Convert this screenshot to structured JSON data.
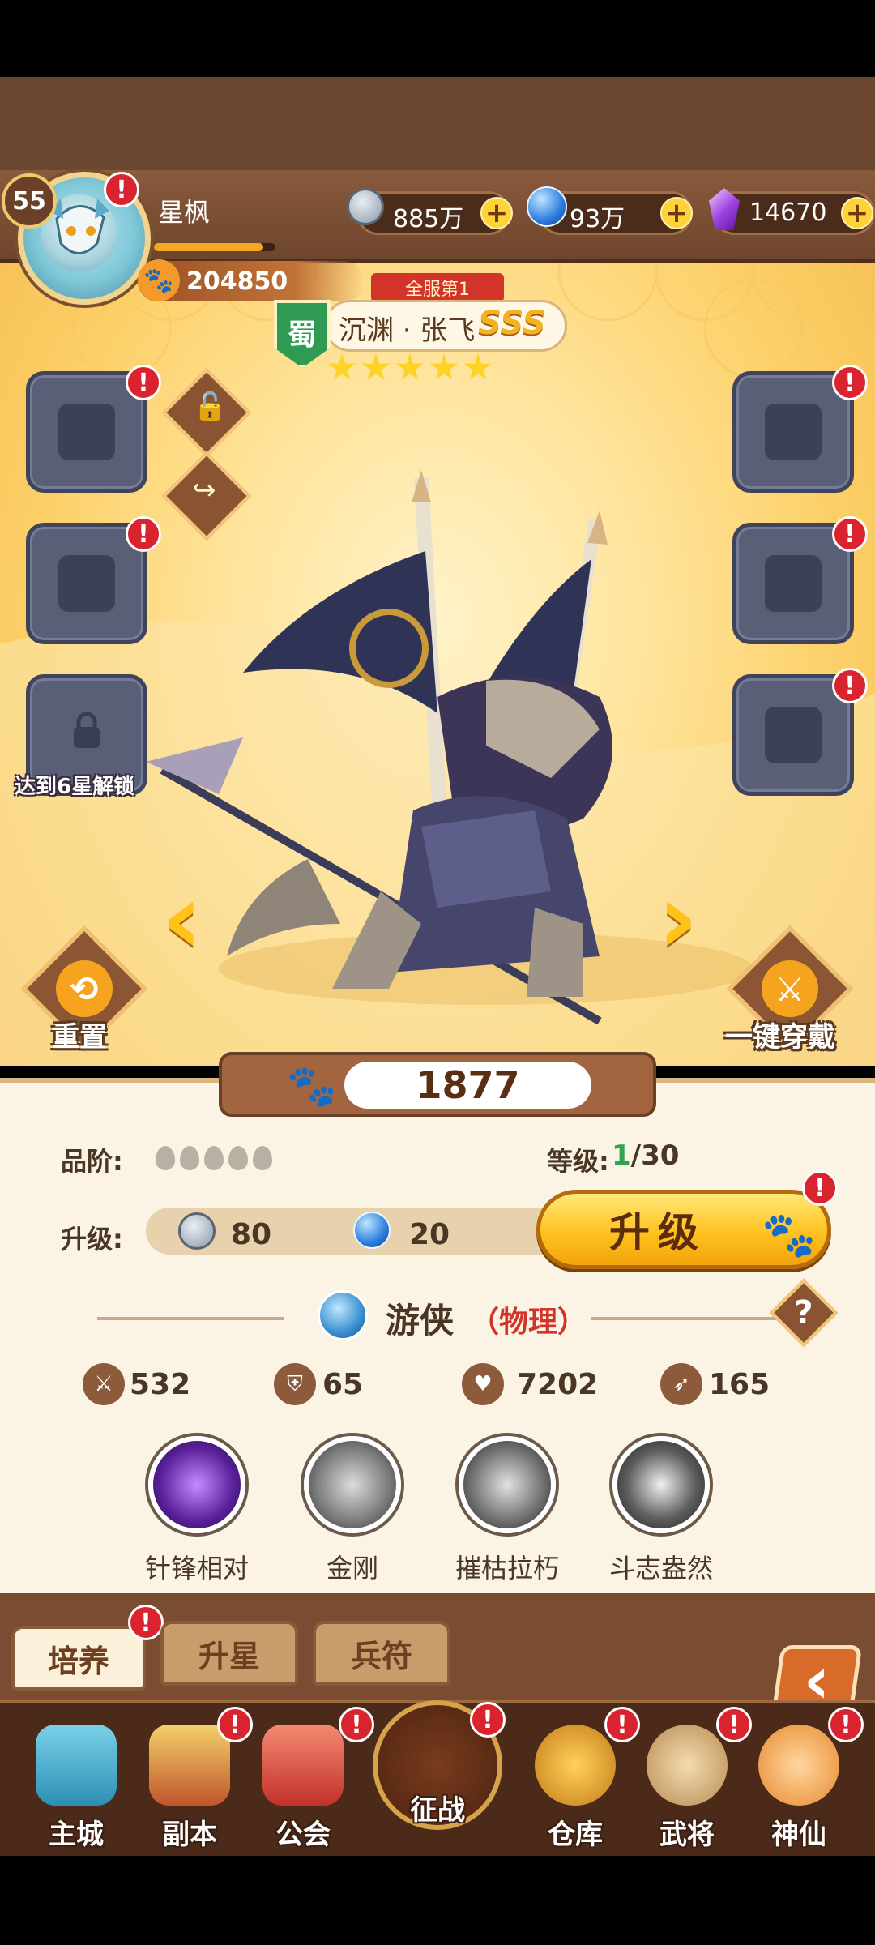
{
  "player": {
    "level": "55",
    "name": "星枫",
    "power": "204850",
    "alert": "!"
  },
  "resources": {
    "coins": "885万",
    "orbs": "93万",
    "gems": "14670",
    "plus": "+"
  },
  "hero": {
    "server_rank": "全服第1",
    "faction": "蜀",
    "name": "沉渊 · 张飞",
    "grade": "SSS",
    "stars": 5,
    "combat_power": "1877"
  },
  "slots": {
    "lock_caption": "达到6星解锁"
  },
  "actions": {
    "reset": "重置",
    "equip_all": "一键穿戴"
  },
  "arrows": {
    "left": "‹",
    "right": "›"
  },
  "details": {
    "quality_label": "品阶:",
    "level_label": "等级:",
    "level_current": "1",
    "level_max": "/30",
    "upgrade_label": "升级:",
    "coin_cost": "80",
    "orb_cost": "20",
    "upgrade_button": "升级",
    "class_name": "游侠",
    "class_type": "（物理）",
    "help": "?"
  },
  "stats": {
    "attack": "532",
    "defense": "65",
    "hp": "7202",
    "speed": "165"
  },
  "skills": [
    "针锋相对",
    "金刚",
    "摧枯拉朽",
    "斗志盎然"
  ],
  "tabs": [
    "培养",
    "升星",
    "兵符"
  ],
  "back": "‹",
  "nav": [
    "主城",
    "副本",
    "公会",
    "征战",
    "仓库",
    "武将",
    "神仙"
  ]
}
